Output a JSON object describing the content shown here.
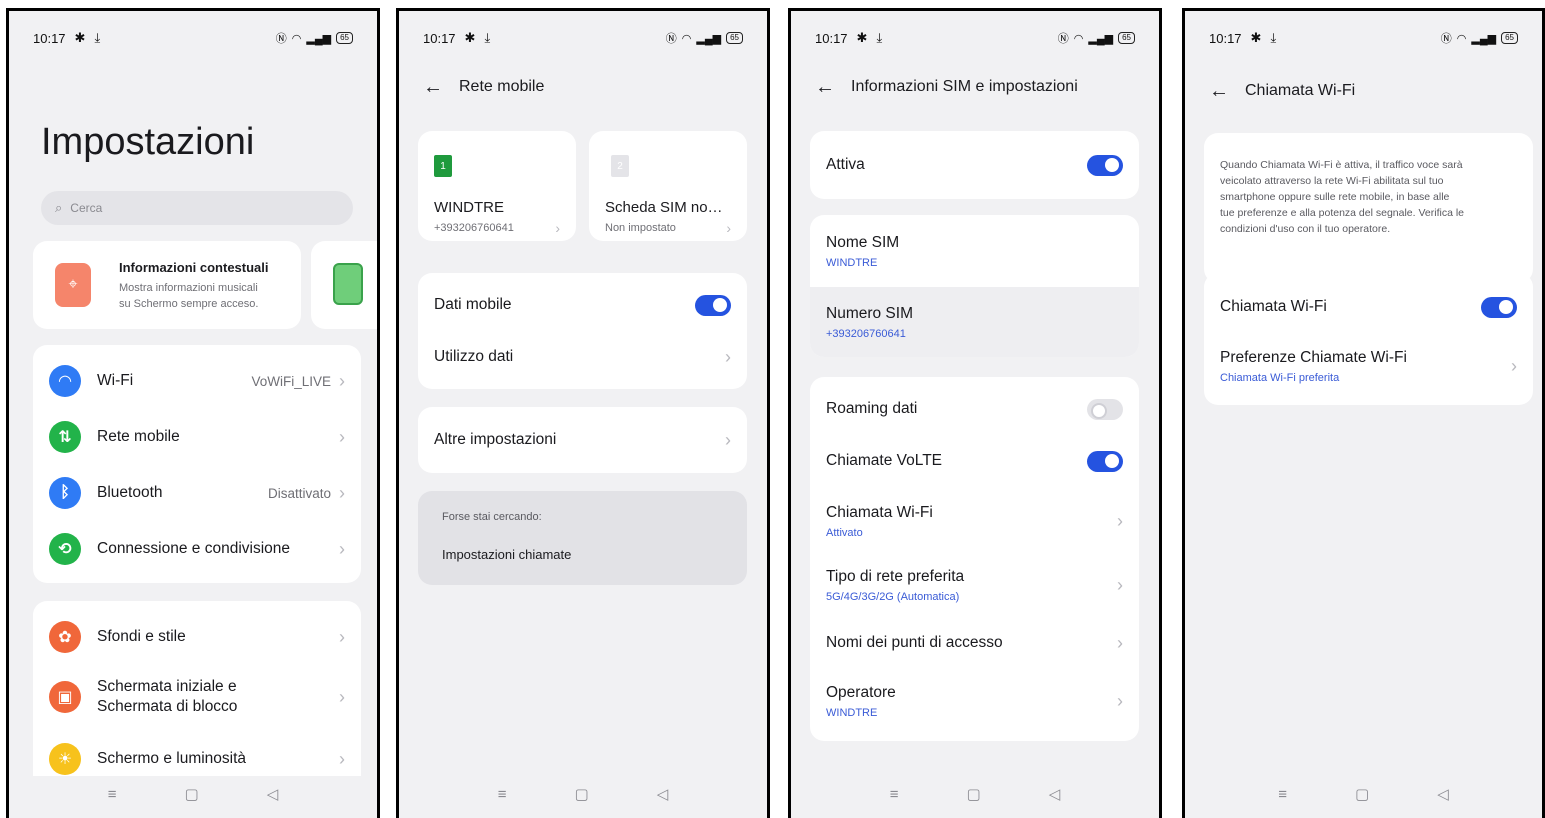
{
  "status": {
    "time": "10:17",
    "battery": "65"
  },
  "screen1": {
    "title": "Impostazioni",
    "search_placeholder": "Cerca",
    "banner": {
      "title": "Informazioni contestuali",
      "desc_line1": "Mostra informazioni musicali",
      "desc_line2": "su Schermo sempre acceso."
    },
    "group1": [
      {
        "label": "Wi-Fi",
        "value": "VoWiFi_LIVE",
        "color": "#2f7bf5"
      },
      {
        "label": "Rete mobile",
        "value": "",
        "color": "#22b34a"
      },
      {
        "label": "Bluetooth",
        "value": "Disattivato",
        "color": "#2f7bf5"
      },
      {
        "label": "Connessione e condivisione",
        "value": "",
        "color": "#22b34a"
      }
    ],
    "group2": [
      {
        "label": "Sfondi e stile",
        "color": "#f0673a"
      },
      {
        "label_line1": "Schermata iniziale e",
        "label_line2": "Schermata di blocco",
        "color": "#f0673a"
      },
      {
        "label": "Schermo e luminosità",
        "color": "#f7c21c"
      }
    ]
  },
  "screen2": {
    "header": "Rete mobile",
    "sim1": {
      "num": "1",
      "name": "WINDTRE",
      "number": "+393206760641"
    },
    "sim2": {
      "num": "2",
      "name": "Scheda SIM no…",
      "status": "Non impostato"
    },
    "dati_mobile": "Dati mobile",
    "utilizzo_dati": "Utilizzo dati",
    "altre": "Altre impostazioni",
    "suggest_title": "Forse stai cercando:",
    "suggest_item": "Impostazioni chiamate"
  },
  "screen3": {
    "header": "Informazioni SIM e impostazioni",
    "attiva": "Attiva",
    "nome_sim": "Nome SIM",
    "nome_sim_val": "WINDTRE",
    "numero_sim": "Numero SIM",
    "numero_sim_val": "+393206760641",
    "roaming": "Roaming dati",
    "volte": "Chiamate VoLTE",
    "wifi_call": "Chiamata Wi-Fi",
    "wifi_call_val": "Attivato",
    "tipo_rete": "Tipo di rete preferita",
    "tipo_rete_val": "5G/4G/3G/2G (Automatica)",
    "apn": "Nomi dei punti di accesso",
    "operatore": "Operatore",
    "operatore_val": "WINDTRE"
  },
  "screen4": {
    "header": "Chiamata Wi-Fi",
    "info_line1": "Quando Chiamata Wi-Fi è attiva, il traffico voce sarà",
    "info_line2": "veicolato attraverso la rete Wi-Fi abilitata sul tuo",
    "info_line3": "smartphone oppure sulle rete mobile, in base alle",
    "info_line4": "tue preferenze e alla potenza del segnale. Verifica le",
    "info_line5": "condizioni d'uso con il tuo operatore.",
    "toggle_label": "Chiamata Wi-Fi",
    "pref_label": "Preferenze Chiamate Wi-Fi",
    "pref_value": "Chiamata Wi-Fi preferita"
  },
  "nav": {
    "menu": "≡",
    "home": "▢",
    "back": "◁"
  }
}
